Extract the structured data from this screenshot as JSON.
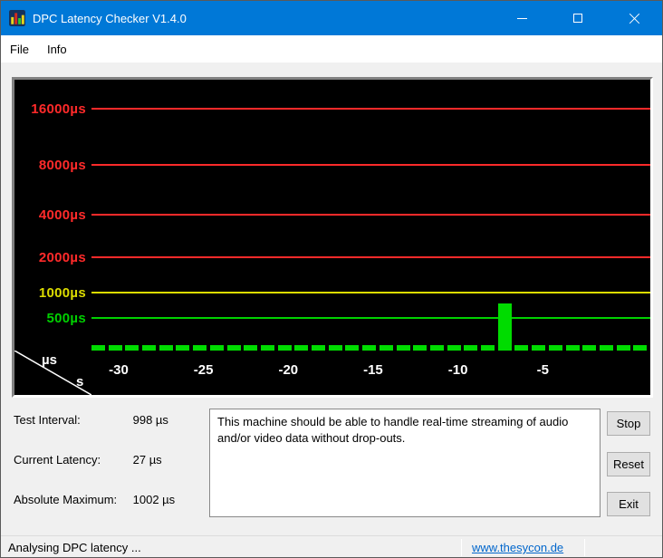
{
  "window": {
    "title": "DPC Latency Checker V1.4.0"
  },
  "menu": {
    "items": [
      {
        "label": "File"
      },
      {
        "label": "Info"
      }
    ]
  },
  "chart_data": {
    "type": "bar",
    "description": "DPC latency history, one green bar per second, most recent at the right",
    "x_axis": {
      "unit_top": "µs",
      "unit_bottom": "s",
      "ticks": [
        "-30",
        "-25",
        "-20",
        "-15",
        "-10",
        "-5"
      ],
      "seconds_per_bar": 1,
      "range_s": [
        -33,
        0
      ]
    },
    "y_gridlines": [
      {
        "value": 16000,
        "label": "16000µs",
        "color": "#ff2a2a"
      },
      {
        "value": 8000,
        "label": "8000µs",
        "color": "#ff2a2a"
      },
      {
        "value": 4000,
        "label": "4000µs",
        "color": "#ff2a2a"
      },
      {
        "value": 2000,
        "label": "2000µs",
        "color": "#ff2a2a"
      },
      {
        "value": 1000,
        "label": "1000µs",
        "color": "#dcdc00"
      },
      {
        "value": 500,
        "label": "500µs",
        "color": "#00d000"
      }
    ],
    "bar_color": "#00dc00",
    "values_us": [
      27,
      27,
      27,
      27,
      27,
      27,
      27,
      27,
      27,
      27,
      27,
      27,
      27,
      27,
      27,
      27,
      27,
      27,
      27,
      27,
      27,
      27,
      27,
      27,
      1002,
      27,
      27,
      27,
      27,
      27,
      27,
      27,
      27
    ]
  },
  "stats": {
    "rows": [
      {
        "label": "Test Interval:",
        "value": "998 µs"
      },
      {
        "label": "Current Latency:",
        "value": "27 µs"
      },
      {
        "label": "Absolute Maximum:",
        "value": "1002 µs"
      }
    ]
  },
  "message": {
    "text": "This machine should be able to handle real-time streaming of audio and/or video data without drop-outs."
  },
  "buttons": [
    {
      "label": "Stop"
    },
    {
      "label": "Reset"
    },
    {
      "label": "Exit"
    }
  ],
  "statusbar": {
    "status": "Analysing DPC latency ...",
    "link": "www.thesycon.de"
  }
}
